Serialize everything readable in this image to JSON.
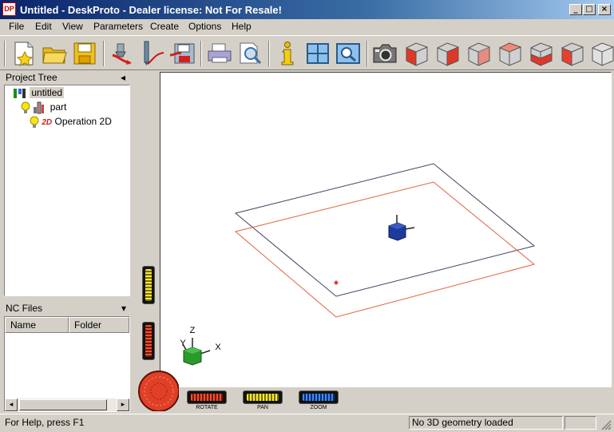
{
  "window": {
    "title": "Untitled - DeskProto - Dealer license: Not For Resale!",
    "app_icon_text": "DP",
    "minimize_glyph": "_",
    "maximize_glyph": "□",
    "close_glyph": "×"
  },
  "menu": [
    "File",
    "Edit",
    "View",
    "Parameters",
    "Create",
    "Options",
    "Help"
  ],
  "toolbar": {
    "buttons": [
      "new-icon",
      "open-folder-icon",
      "save-icon",
      "wizard-icon",
      "toolpath-icon",
      "save-nc-icon",
      "print-icon",
      "print-preview-icon",
      "info-icon",
      "layout-icon",
      "zoom-window-icon",
      "camera-icon",
      "view-front-icon",
      "view-back-icon",
      "view-left-icon",
      "view-right-icon",
      "view-top-icon",
      "view-bottom-icon",
      "view-iso-icon"
    ]
  },
  "project_tree": {
    "title": "Project Tree",
    "collapse_glyph": "◂",
    "items": [
      {
        "label": "untitled",
        "level": 0,
        "selected": true
      },
      {
        "label": "part",
        "level": 1
      },
      {
        "label": "Operation 2D",
        "level": 2,
        "badge": "2D"
      }
    ]
  },
  "nc_files": {
    "title": "NC Files",
    "dropdown_glyph": "▾",
    "columns": [
      "Name",
      "Folder"
    ],
    "scroll_left": "◂",
    "scroll_right": "▸"
  },
  "viewport": {
    "axes": {
      "x": "X",
      "y": "Y",
      "z": "Z"
    }
  },
  "dials": {
    "rotate": "ROTATE",
    "pan": "PAN",
    "zoom": "ZOOM"
  },
  "status": {
    "help": "For Help, press F1",
    "geometry": "No 3D geometry loaded"
  },
  "colors": {
    "title_bar": "#0a246a",
    "chrome": "#d4d0c8",
    "stock_outline": "#e06040",
    "part_outline": "#404060",
    "origin_cube": "#1e3a9a",
    "axis_cube": "#2a9a2a"
  }
}
